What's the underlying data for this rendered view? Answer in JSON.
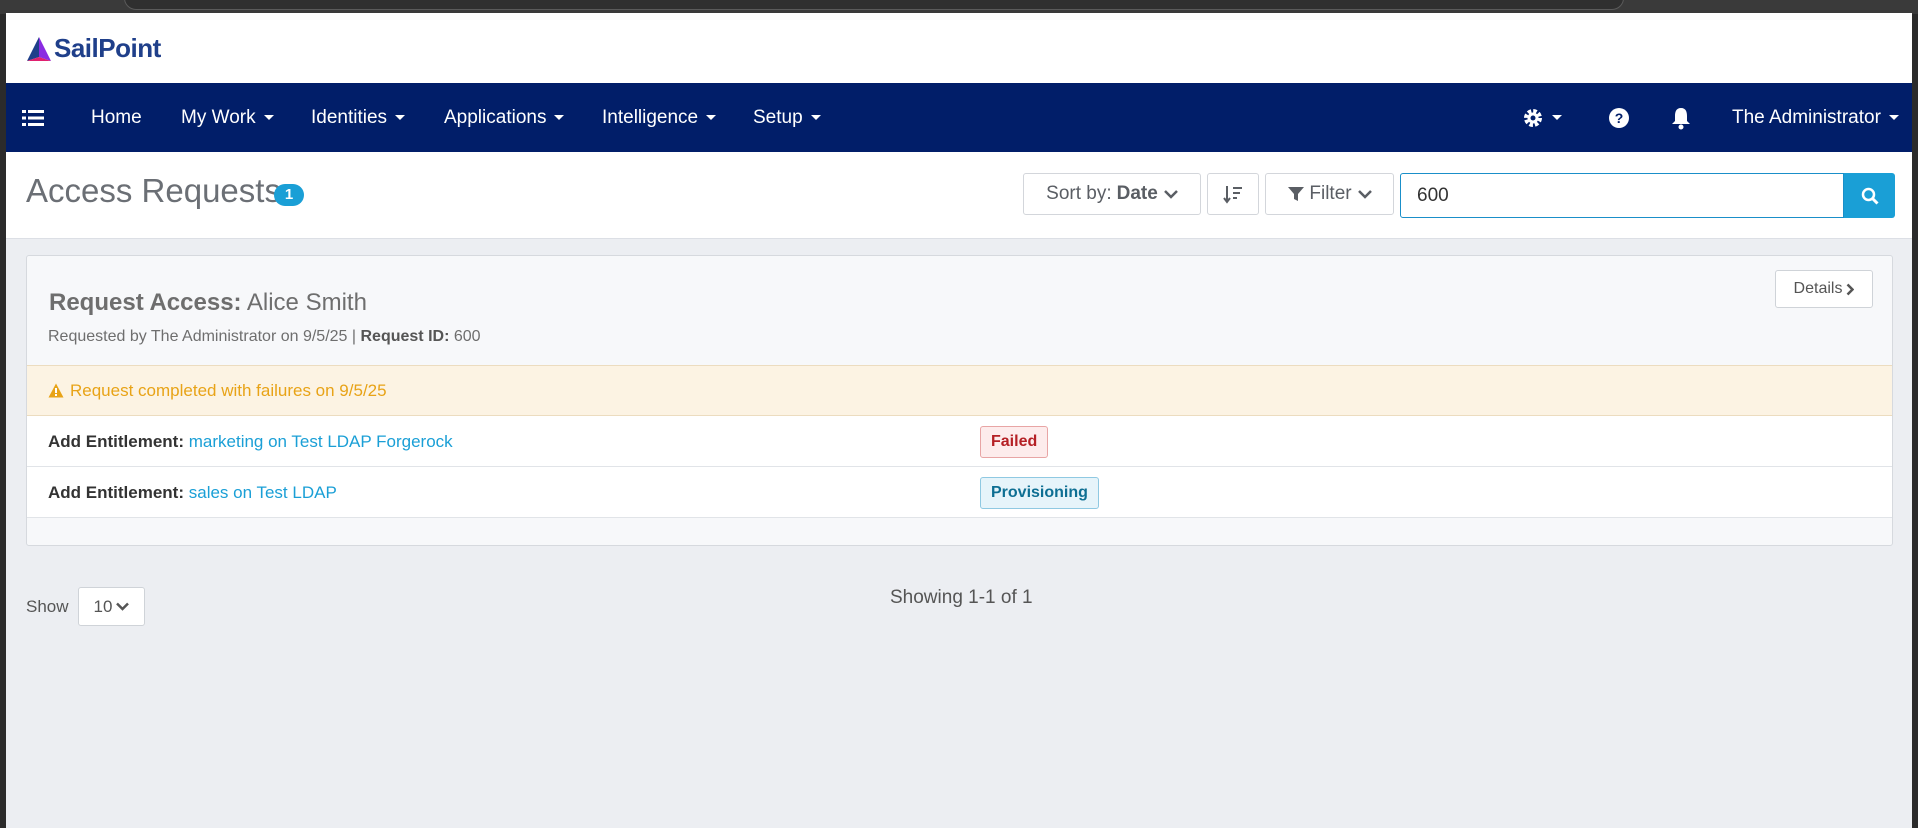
{
  "app": {
    "brand": "SailPoint"
  },
  "nav": {
    "items": [
      {
        "label": "Home",
        "dropdown": false
      },
      {
        "label": "My Work",
        "dropdown": true
      },
      {
        "label": "Identities",
        "dropdown": true
      },
      {
        "label": "Applications",
        "dropdown": true
      },
      {
        "label": "Intelligence",
        "dropdown": true
      },
      {
        "label": "Setup",
        "dropdown": true
      }
    ],
    "user_name": "The Administrator",
    "icons": [
      "menu-list-icon",
      "gear-icon",
      "help-icon",
      "bell-icon"
    ]
  },
  "toolbar": {
    "title": "Access Requests",
    "count": "1",
    "sort_prefix": "Sort by:",
    "sort_value": "Date",
    "filter_label": "Filter",
    "search_value": "600"
  },
  "request": {
    "title_prefix": "Request Access:",
    "title_name": "Alice Smith",
    "requested_by_text": "Requested by The Administrator on 9/5/25 |",
    "request_id_label": "Request ID:",
    "request_id": "600",
    "details_label": "Details",
    "warning_text": "Request completed with failures on 9/5/25",
    "items": [
      {
        "action": "Add Entitlement:",
        "target": "marketing on Test LDAP Forgerock",
        "status": "Failed"
      },
      {
        "action": "Add Entitlement:",
        "target": "sales on Test LDAP",
        "status": "Provisioning"
      }
    ]
  },
  "pagination": {
    "show_label": "Show",
    "page_size": "10",
    "summary": "Showing 1-1 of 1"
  },
  "colors": {
    "nav_bg": "#011e69",
    "accent": "#1a9fd6",
    "warning": "#e8a317",
    "failed": "#b52025"
  }
}
